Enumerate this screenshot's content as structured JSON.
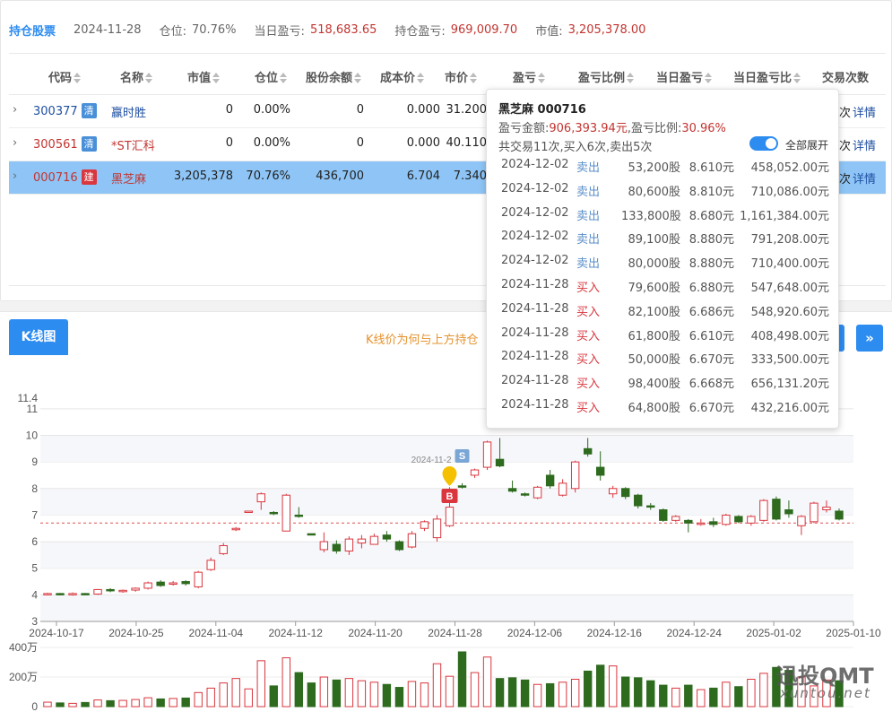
{
  "summary": {
    "title": "持仓股票",
    "date": "2024-11-28",
    "position_label": "仓位:",
    "position_value": "70.76%",
    "daily_pnl_label": "当日盈亏:",
    "daily_pnl_value": "518,683.65",
    "hold_pnl_label": "持仓盈亏:",
    "hold_pnl_value": "969,009.70",
    "market_value_label": "市值:",
    "market_value_value": "3,205,378.00"
  },
  "table": {
    "headers": [
      "代码",
      "名称",
      "市值",
      "仓位",
      "股份余额",
      "成本价",
      "市价",
      "盈亏",
      "盈亏比例",
      "当日盈亏",
      "当日盈亏比",
      "交易次数"
    ],
    "rows": [
      {
        "code": "300377",
        "badge": "清",
        "name": "赢时胜",
        "market_value": "0",
        "position": "0.00%",
        "shares": "0",
        "cost": "0.000",
        "price": "31.200",
        "trades_tail": "次",
        "detail": "详情"
      },
      {
        "code": "300561",
        "badge": "清",
        "name": "*ST汇科",
        "market_value": "0",
        "position": "0.00%",
        "shares": "0",
        "cost": "0.000",
        "price": "40.110",
        "trades_tail": "次",
        "detail": "详情"
      },
      {
        "code": "000716",
        "badge": "建",
        "name": "黑芝麻",
        "market_value": "3,205,378",
        "position": "70.76%",
        "shares": "436,700",
        "cost": "6.704",
        "price": "7.340",
        "trades_tail": "次",
        "detail": "详情"
      }
    ]
  },
  "kline": {
    "tab_label": "K线图",
    "note": "K线价为何与上方持仓",
    "next_icon": "»"
  },
  "tooltip": {
    "title": "黑芝麻 000716",
    "pnl_amount_label": "盈亏金额:",
    "pnl_amount": "906,393.94元",
    "pnl_ratio_label": ",盈亏比例:",
    "pnl_ratio": "30.96%",
    "trade_summary": "共交易11次,买入6次,卖出5次",
    "expand_all_label": "全部展开",
    "trades": [
      {
        "date": "2024-12-02",
        "type": "卖出",
        "shares": "53,200股",
        "price": "8.610元",
        "amount": "458,052.00元"
      },
      {
        "date": "2024-12-02",
        "type": "卖出",
        "shares": "80,600股",
        "price": "8.810元",
        "amount": "710,086.00元"
      },
      {
        "date": "2024-12-02",
        "type": "卖出",
        "shares": "133,800股",
        "price": "8.680元",
        "amount": "1,161,384.00元"
      },
      {
        "date": "2024-12-02",
        "type": "卖出",
        "shares": "89,100股",
        "price": "8.880元",
        "amount": "791,208.00元"
      },
      {
        "date": "2024-12-02",
        "type": "卖出",
        "shares": "80,000股",
        "price": "8.880元",
        "amount": "710,400.00元"
      },
      {
        "date": "2024-11-28",
        "type": "买入",
        "shares": "79,600股",
        "price": "6.880元",
        "amount": "547,648.00元"
      },
      {
        "date": "2024-11-28",
        "type": "买入",
        "shares": "82,100股",
        "price": "6.686元",
        "amount": "548,920.60元"
      },
      {
        "date": "2024-11-28",
        "type": "买入",
        "shares": "61,800股",
        "price": "6.610元",
        "amount": "408,498.00元"
      },
      {
        "date": "2024-11-28",
        "type": "买入",
        "shares": "50,000股",
        "price": "6.670元",
        "amount": "333,500.00元"
      },
      {
        "date": "2024-11-28",
        "type": "买入",
        "shares": "98,400股",
        "price": "6.668元",
        "amount": "656,131.20元"
      },
      {
        "date": "2024-11-28",
        "type": "买入",
        "shares": "64,800股",
        "price": "6.670元",
        "amount": "432,216.00元"
      }
    ]
  },
  "chart_data": {
    "type": "candlestick",
    "title": "",
    "y_ticks": [
      "3",
      "4",
      "5",
      "6",
      "7",
      "8",
      "9",
      "10",
      "11",
      "11.4"
    ],
    "y_min": 3,
    "y_max": 11.4,
    "x_ticks": [
      "2024-10-17",
      "2024-10-25",
      "2024-11-04",
      "2024-11-12",
      "2024-11-20",
      "2024-11-28",
      "2024-12-06",
      "2024-12-16",
      "2024-12-24",
      "2025-01-02",
      "2025-01-10"
    ],
    "cost_line": 6.704,
    "buy_marker": {
      "label": "B",
      "date_index": 32
    },
    "sell_marker": {
      "label": "S",
      "date_index": 33
    },
    "marker_date_label": "2024-11-2",
    "up_color": "#d9363e",
    "down_color": "#2e6b1f",
    "candles": [
      [
        4.02,
        4.05,
        3.98,
        4.08
      ],
      [
        4.05,
        4.02,
        3.98,
        4.07
      ],
      [
        4.0,
        4.05,
        3.97,
        4.09
      ],
      [
        4.05,
        4.03,
        4.0,
        4.07
      ],
      [
        4.03,
        4.2,
        4.0,
        4.22
      ],
      [
        4.2,
        4.15,
        4.1,
        4.25
      ],
      [
        4.12,
        4.17,
        4.08,
        4.2
      ],
      [
        4.18,
        4.25,
        4.12,
        4.28
      ],
      [
        4.25,
        4.45,
        4.2,
        4.5
      ],
      [
        4.48,
        4.35,
        4.3,
        4.55
      ],
      [
        4.4,
        4.45,
        4.35,
        4.52
      ],
      [
        4.5,
        4.42,
        4.35,
        4.55
      ],
      [
        4.3,
        4.85,
        4.25,
        4.9
      ],
      [
        4.95,
        5.3,
        4.9,
        5.4
      ],
      [
        5.55,
        5.85,
        5.5,
        5.95
      ],
      [
        6.45,
        6.5,
        6.4,
        6.55
      ],
      [
        7.1,
        7.15,
        7.1,
        7.15
      ],
      [
        7.5,
        7.8,
        7.2,
        7.85
      ],
      [
        7.1,
        7.05,
        7.0,
        7.15
      ],
      [
        6.4,
        7.75,
        6.4,
        7.8
      ],
      [
        7.0,
        6.95,
        6.9,
        7.3
      ],
      [
        6.3,
        6.27,
        6.25,
        6.3
      ],
      [
        5.7,
        6.0,
        5.6,
        6.35
      ],
      [
        5.9,
        5.65,
        5.55,
        6.05
      ],
      [
        5.65,
        6.1,
        5.5,
        6.2
      ],
      [
        5.95,
        6.1,
        5.75,
        6.25
      ],
      [
        5.9,
        6.2,
        5.9,
        6.3
      ],
      [
        6.25,
        6.1,
        6.0,
        6.4
      ],
      [
        6.0,
        5.7,
        5.65,
        6.05
      ],
      [
        5.8,
        6.3,
        5.75,
        6.4
      ],
      [
        6.5,
        6.75,
        6.4,
        6.8
      ],
      [
        6.15,
        6.85,
        6.0,
        7.0
      ],
      [
        6.6,
        7.3,
        6.55,
        8.05
      ],
      [
        8.1,
        8.05,
        8.0,
        8.2
      ],
      [
        8.5,
        8.7,
        8.4,
        8.75
      ],
      [
        8.8,
        9.75,
        8.7,
        9.8
      ],
      [
        9.1,
        8.85,
        8.8,
        9.9
      ],
      [
        8.0,
        7.9,
        7.85,
        8.3
      ],
      [
        7.8,
        7.75,
        7.7,
        7.85
      ],
      [
        7.65,
        8.05,
        7.6,
        8.1
      ],
      [
        8.5,
        8.1,
        8.0,
        8.7
      ],
      [
        7.75,
        8.2,
        7.7,
        8.35
      ],
      [
        8.0,
        9.0,
        7.85,
        9.05
      ],
      [
        9.5,
        9.3,
        9.2,
        9.9
      ],
      [
        8.8,
        8.5,
        8.3,
        9.4
      ],
      [
        7.8,
        8.0,
        7.65,
        8.1
      ],
      [
        8.0,
        7.7,
        7.6,
        8.05
      ],
      [
        7.75,
        7.35,
        7.25,
        7.8
      ],
      [
        7.35,
        7.3,
        7.2,
        7.45
      ],
      [
        7.2,
        6.8,
        6.75,
        7.25
      ],
      [
        6.8,
        6.95,
        6.75,
        7.0
      ],
      [
        6.8,
        6.7,
        6.35,
        6.85
      ],
      [
        6.65,
        6.7,
        6.6,
        6.85
      ],
      [
        6.75,
        6.65,
        6.55,
        6.9
      ],
      [
        6.65,
        7.0,
        6.6,
        7.05
      ],
      [
        6.95,
        6.75,
        6.7,
        7.0
      ],
      [
        6.7,
        6.95,
        6.6,
        7.0
      ],
      [
        6.8,
        7.55,
        6.75,
        7.6
      ],
      [
        7.6,
        6.85,
        6.8,
        7.7
      ],
      [
        7.2,
        7.05,
        6.9,
        7.55
      ],
      [
        6.6,
        6.95,
        6.25,
        7.0
      ],
      [
        6.75,
        7.45,
        6.7,
        7.5
      ],
      [
        7.2,
        7.3,
        7.1,
        7.55
      ],
      [
        7.15,
        6.85,
        6.8,
        7.25
      ]
    ],
    "volume_ticks": [
      "0",
      "200万",
      "400万"
    ],
    "volume_max": 400,
    "volumes": [
      30,
      25,
      22,
      28,
      45,
      40,
      42,
      48,
      60,
      52,
      55,
      58,
      95,
      125,
      160,
      190,
      120,
      310,
      140,
      330,
      230,
      160,
      200,
      180,
      190,
      175,
      165,
      150,
      130,
      170,
      160,
      290,
      205,
      370,
      230,
      335,
      190,
      195,
      180,
      150,
      155,
      165,
      185,
      240,
      280,
      275,
      200,
      195,
      175,
      145,
      125,
      145,
      115,
      125,
      165,
      135,
      185,
      225,
      265,
      245,
      200,
      140,
      180,
      175
    ]
  }
}
